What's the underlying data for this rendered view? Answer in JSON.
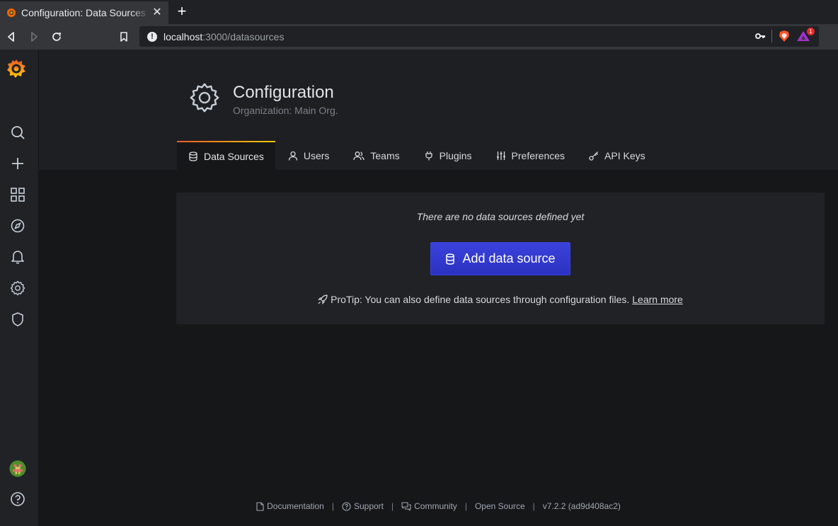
{
  "browser": {
    "tab_title": "Configuration: Data Sources - Grafana",
    "url_host": "localhost",
    "url_path": ":3000/datasources",
    "notification_count": "1"
  },
  "page": {
    "title": "Configuration",
    "subtitle": "Organization: Main Org."
  },
  "tabs": [
    {
      "label": "Data Sources",
      "icon": "database-icon",
      "active": true
    },
    {
      "label": "Users",
      "icon": "user-icon"
    },
    {
      "label": "Teams",
      "icon": "users-icon"
    },
    {
      "label": "Plugins",
      "icon": "plug-icon"
    },
    {
      "label": "Preferences",
      "icon": "sliders-icon"
    },
    {
      "label": "API Keys",
      "icon": "key-icon"
    }
  ],
  "content": {
    "empty_message": "There are no data sources defined yet",
    "add_button": "Add data source",
    "protip": "ProTip: You can also define data sources through configuration files.",
    "learn_more": "Learn more"
  },
  "footer": {
    "documentation": "Documentation",
    "support": "Support",
    "community": "Community",
    "open_source": "Open Source",
    "version": "v7.2.2 (ad9d408ac2)"
  },
  "colors": {
    "primary_button": "#3138d1",
    "accent_gradient_start": "#f05a28",
    "accent_gradient_end": "#fbca0a"
  }
}
